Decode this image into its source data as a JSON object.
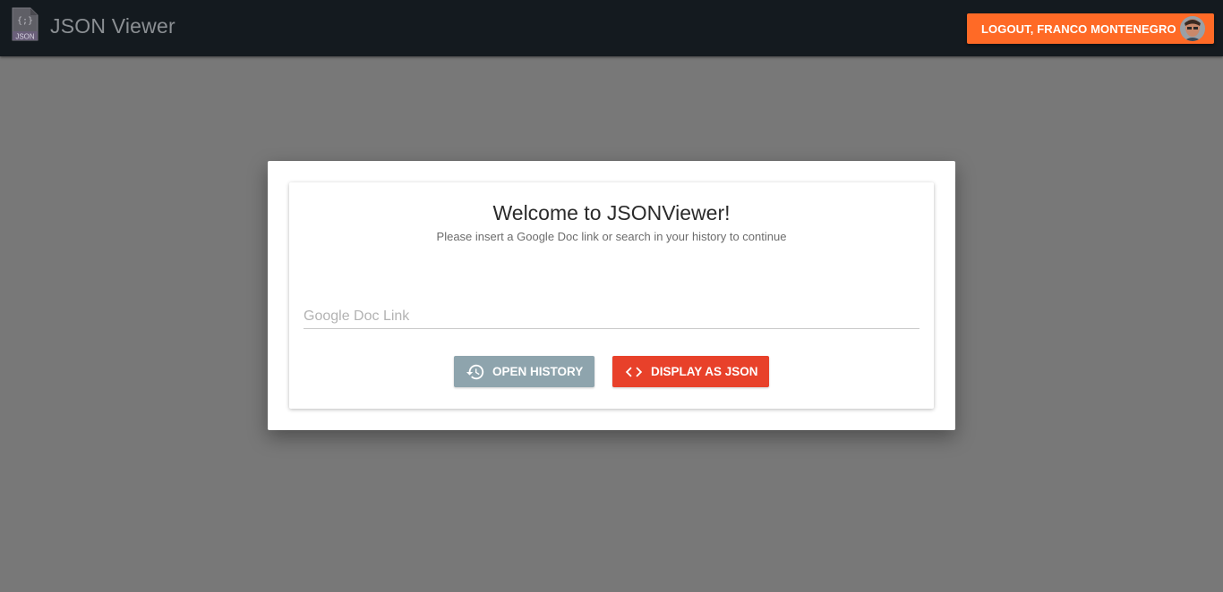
{
  "header": {
    "app_title": "JSON Viewer",
    "logo_icon": "json-file-icon",
    "logo_text": "JSON",
    "logout_label": "LOGOUT, FRANCO MONTENEGRO",
    "accent_color": "#ff6a26"
  },
  "dialog": {
    "title": "Welcome to JSONViewer!",
    "subtitle": "Please insert a Google Doc link or search in your history to continue",
    "input": {
      "placeholder": "Google Doc Link",
      "value": ""
    },
    "buttons": {
      "history": {
        "label": "OPEN HISTORY",
        "icon": "history-icon",
        "color": "#8ea4ad"
      },
      "display": {
        "label": "DISPLAY AS JSON",
        "icon": "code-icon",
        "color": "#e8412a"
      }
    }
  }
}
